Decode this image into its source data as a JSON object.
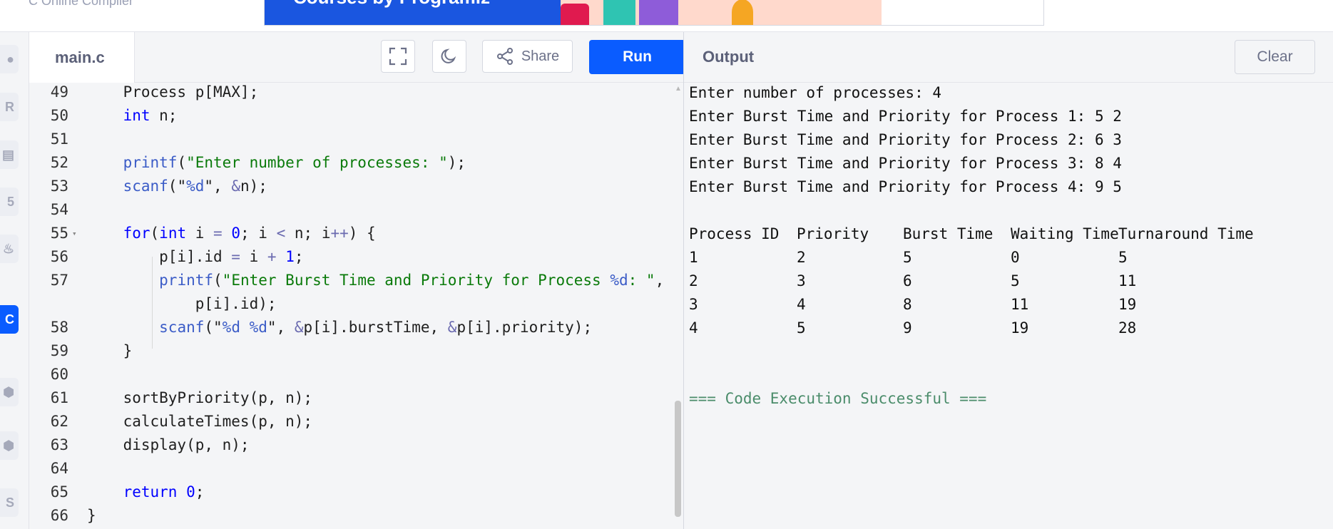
{
  "banner": {
    "brand_text": "C Online Compiler",
    "ad_text": "Courses by Programiz"
  },
  "editor": {
    "file_name": "main.c",
    "share_label": "Share",
    "run_label": "Run",
    "lines": [
      {
        "num": "49",
        "tokens": [
          [
            "",
            "    Process p[MAX];"
          ]
        ]
      },
      {
        "num": "50",
        "tokens": [
          [
            "",
            "    "
          ],
          [
            "kw",
            "int"
          ],
          [
            "",
            " n;"
          ]
        ]
      },
      {
        "num": "51",
        "tokens": []
      },
      {
        "num": "52",
        "tokens": [
          [
            "",
            "    "
          ],
          [
            "fn",
            "printf"
          ],
          [
            "",
            "("
          ],
          [
            "str",
            "\"Enter number of processes: \""
          ],
          [
            "",
            ");"
          ]
        ]
      },
      {
        "num": "53",
        "tokens": [
          [
            "",
            "    "
          ],
          [
            "fn",
            "scanf"
          ],
          [
            "",
            "(\""
          ],
          [
            "fn",
            "%d"
          ],
          [
            "",
            "\", "
          ],
          [
            "op",
            "&"
          ],
          [
            "",
            "n);"
          ]
        ]
      },
      {
        "num": "54",
        "tokens": []
      },
      {
        "num": "55",
        "fold": true,
        "tokens": [
          [
            "",
            "    "
          ],
          [
            "kw",
            "for"
          ],
          [
            "",
            "("
          ],
          [
            "kw",
            "int"
          ],
          [
            "",
            " i "
          ],
          [
            "op",
            "="
          ],
          [
            "",
            " "
          ],
          [
            "num",
            "0"
          ],
          [
            "",
            "; i "
          ],
          [
            "op",
            "<"
          ],
          [
            "",
            " n; i"
          ],
          [
            "op",
            "++"
          ],
          [
            "",
            ") {"
          ]
        ]
      },
      {
        "num": "56",
        "tokens": [
          [
            "",
            "        p[i].id "
          ],
          [
            "op",
            "="
          ],
          [
            "",
            " i "
          ],
          [
            "op",
            "+"
          ],
          [
            "",
            " "
          ],
          [
            "num",
            "1"
          ],
          [
            "",
            ";"
          ]
        ]
      },
      {
        "num": "57",
        "tokens": [
          [
            "",
            "        "
          ],
          [
            "fn",
            "printf"
          ],
          [
            "",
            "("
          ],
          [
            "str",
            "\"Enter Burst Time and Priority for Process "
          ],
          [
            "fn",
            "%d"
          ],
          [
            "str",
            ": \""
          ],
          [
            "",
            ","
          ]
        ]
      },
      {
        "num": "",
        "tokens": [
          [
            "",
            "            p[i].id);"
          ]
        ]
      },
      {
        "num": "58",
        "tokens": [
          [
            "",
            "        "
          ],
          [
            "fn",
            "scanf"
          ],
          [
            "",
            "(\""
          ],
          [
            "fn",
            "%d %d"
          ],
          [
            "",
            "\", "
          ],
          [
            "op",
            "&"
          ],
          [
            "",
            "p[i].burstTime, "
          ],
          [
            "op",
            "&"
          ],
          [
            "",
            "p[i].priority);"
          ]
        ]
      },
      {
        "num": "59",
        "tokens": [
          [
            "",
            "    }"
          ]
        ]
      },
      {
        "num": "60",
        "tokens": []
      },
      {
        "num": "61",
        "tokens": [
          [
            "",
            "    sortByPriority(p, n);"
          ]
        ]
      },
      {
        "num": "62",
        "tokens": [
          [
            "",
            "    calculateTimes(p, n);"
          ]
        ]
      },
      {
        "num": "63",
        "tokens": [
          [
            "",
            "    display(p, n);"
          ]
        ]
      },
      {
        "num": "64",
        "tokens": []
      },
      {
        "num": "65",
        "tokens": [
          [
            "",
            "    "
          ],
          [
            "kw",
            "return"
          ],
          [
            "",
            " "
          ],
          [
            "num",
            "0"
          ],
          [
            "",
            ";"
          ]
        ]
      },
      {
        "num": "66",
        "tokens": [
          [
            "",
            "}"
          ]
        ]
      }
    ]
  },
  "output": {
    "title": "Output",
    "clear_label": "Clear",
    "input_lines": [
      "Enter number of processes: 4",
      "Enter Burst Time and Priority for Process 1: 5 2",
      "Enter Burst Time and Priority for Process 2: 6 3",
      "Enter Burst Time and Priority for Process 3: 8 4",
      "Enter Burst Time and Priority for Process 4: 9 5"
    ],
    "table_header": [
      "Process ID",
      "Priority",
      "Burst Time",
      "Waiting Time",
      "Turnaround Time"
    ],
    "table_rows": [
      [
        "1",
        "2",
        "5",
        "0",
        "5"
      ],
      [
        "2",
        "3",
        "6",
        "5",
        "11"
      ],
      [
        "3",
        "4",
        "8",
        "11",
        "19"
      ],
      [
        "4",
        "5",
        "9",
        "19",
        "28"
      ]
    ],
    "success_text": "=== Code Execution Successful ==="
  },
  "colors": {
    "accent": "#0a5cff",
    "keyword": "#0000ff",
    "string": "#0a7a0a",
    "success": "#4a8c6a"
  },
  "icons": {
    "rail": [
      "python-icon",
      "r-icon",
      "sql-icon",
      "html-icon",
      "java-icon",
      "c-icon",
      "cpp-icon",
      "csharp-icon",
      "js-icon"
    ],
    "toolbar": [
      "fullscreen-icon",
      "dark-mode-icon",
      "share-icon"
    ]
  }
}
